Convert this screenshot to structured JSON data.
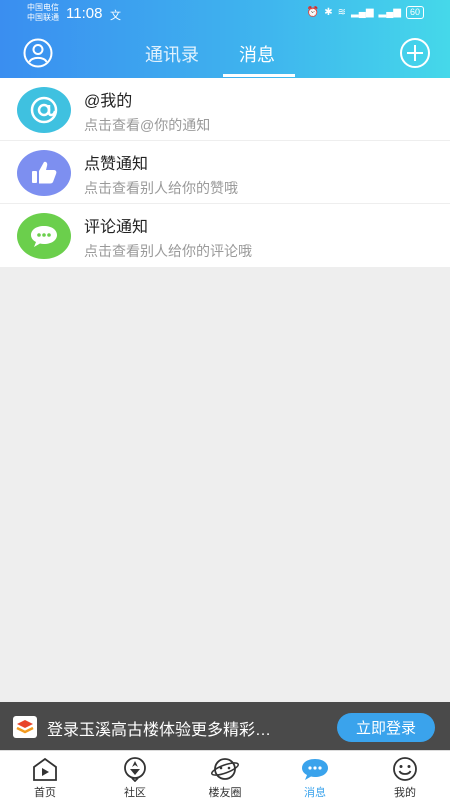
{
  "status_bar": {
    "carrier_1": "中国电信",
    "carrier_2": "中国联通",
    "time": "11:08",
    "time_extra": "文",
    "battery": "60"
  },
  "header": {
    "tabs": [
      {
        "label": "通讯录",
        "active": false
      },
      {
        "label": "消息",
        "active": true
      }
    ]
  },
  "notifications": [
    {
      "title": "@我的",
      "subtitle": "点击查看@你的通知",
      "icon": "at-icon",
      "color": "#3fc1e0"
    },
    {
      "title": "点赞通知",
      "subtitle": "点击查看别人给你的赞哦",
      "icon": "thumbs-up-icon",
      "color": "#7d8ff0"
    },
    {
      "title": "评论通知",
      "subtitle": "点击查看别人给你的评论哦",
      "icon": "comment-icon",
      "color": "#6bcf4c"
    }
  ],
  "login_banner": {
    "text": "登录玉溪高古楼体验更多精彩…",
    "button_label": "立即登录"
  },
  "bottom_nav": [
    {
      "label": "首页",
      "icon": "home-play-icon",
      "active": false
    },
    {
      "label": "社区",
      "icon": "community-icon",
      "active": false
    },
    {
      "label": "楼友圈",
      "icon": "planet-icon",
      "active": false
    },
    {
      "label": "消息",
      "icon": "message-icon",
      "active": true
    },
    {
      "label": "我的",
      "icon": "smiley-icon",
      "active": false
    }
  ],
  "colors": {
    "accent": "#3aa3ec",
    "header_start": "#3a8ef0",
    "header_end": "#45d8ea"
  }
}
